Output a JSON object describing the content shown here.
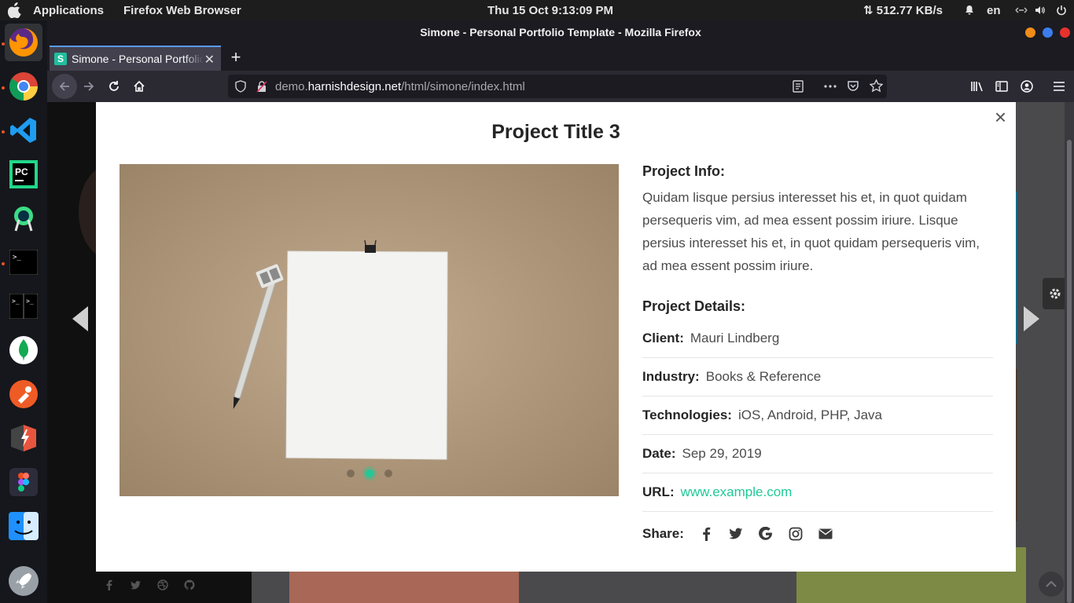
{
  "topbar": {
    "apps_label": "Applications",
    "active_app": "Firefox Web Browser",
    "clock": "Thu 15 Oct   9:13:09 PM",
    "net_speed": "⇅ 512.77 KB/s",
    "lang": "en"
  },
  "window": {
    "title": "Simone - Personal Portfolio Template - Mozilla Firefox",
    "tab_title": "Simone - Personal Portfolio Template",
    "tab_favicon": "S"
  },
  "urlbar": {
    "prefix": "demo.",
    "host": "harnishdesign.net",
    "path": "/html/simone/index.html"
  },
  "modal": {
    "title": "Project Title 3",
    "info_heading": "Project Info:",
    "info_text": "Quidam lisque persius interesset his et, in quot quidam persequeris vim, ad mea essent possim iriure. Lisque persius interesset his et, in quot quidam persequeris vim, ad mea essent possim iriure.",
    "details_heading": "Project Details:",
    "details": [
      {
        "key": "Client:",
        "value": "Mauri Lindberg"
      },
      {
        "key": "Industry:",
        "value": "Books & Reference"
      },
      {
        "key": "Technologies:",
        "value": "iOS, Android, PHP, Java"
      },
      {
        "key": "Date:",
        "value": "Sep 29, 2019"
      }
    ],
    "url_key": "URL:",
    "url_value": "www.example.com",
    "share_label": "Share:",
    "share_icons": [
      "facebook-icon",
      "twitter-icon",
      "google-icon",
      "instagram-icon",
      "envelope-icon"
    ],
    "carousel_active": 2,
    "carousel_count": 3
  },
  "colors": {
    "accent": "#20c997",
    "ubuntu_orange": "#e95420"
  }
}
